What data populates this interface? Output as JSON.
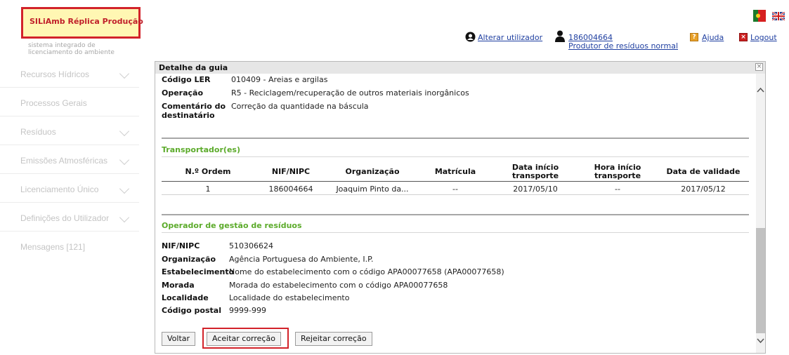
{
  "logo": {
    "title": "SILiAmb Réplica Produção",
    "subtitle_line1": "sistema integrado de",
    "subtitle_line2": "licenciamento do ambiente"
  },
  "sidebar": {
    "items": [
      {
        "label": "Recursos Hídricos",
        "has_chevron": true
      },
      {
        "label": "Processos Gerais",
        "has_chevron": false
      },
      {
        "label": "Resíduos",
        "has_chevron": true
      },
      {
        "label": "Emissões Atmosféricas",
        "has_chevron": true
      },
      {
        "label": "Licenciamento Único",
        "has_chevron": true
      },
      {
        "label": "Definições do Utilizador",
        "has_chevron": true
      },
      {
        "label": "Mensagens [121]",
        "has_chevron": false
      }
    ]
  },
  "header": {
    "change_user": "Alterar utilizador",
    "user_id": "186004664",
    "user_role": "Produtor de resíduos normal",
    "help": "Ajuda",
    "logout": "Logout"
  },
  "modal": {
    "title": "Detalhe da guia",
    "top_fields": [
      {
        "label": "Código LER",
        "value": "010409 - Areias e argilas"
      },
      {
        "label": "Operação",
        "value": "R5 - Reciclagem/recuperação de outros materiais inorgânicos"
      },
      {
        "label_line1": "Comentário do",
        "label_line2": "destinatário",
        "value": "Correção da quantidade na báscula"
      }
    ],
    "transport": {
      "title": "Transportador(es)",
      "columns": [
        "N.º Ordem",
        "NIF/NIPC",
        "Organização",
        "Matrícula",
        "Data início transporte",
        "Hora início transporte",
        "Data de validade"
      ],
      "col_date_start_1": "Data início",
      "col_date_start_2": "transporte",
      "col_hour_start_1": "Hora início",
      "col_hour_start_2": "transporte",
      "rows": [
        {
          "ordem": "1",
          "nif": "186004664",
          "org": "Joaquim Pinto da...",
          "matricula": "--",
          "data_inicio": "2017/05/10",
          "hora_inicio": "--",
          "validade": "2017/05/12"
        }
      ]
    },
    "operator": {
      "title": "Operador de gestão de resíduos",
      "fields": [
        {
          "label": "NIF/NIPC",
          "value": "510306624"
        },
        {
          "label": "Organização",
          "value": "Agência Portuguesa do Ambiente, I.P."
        },
        {
          "label": "Estabelecimento",
          "value": "Nome do estabelecimento com o código APA00077658 (APA00077658)"
        },
        {
          "label": "Morada",
          "value": "Morada do estabelecimento com o código APA00077658"
        },
        {
          "label": "Localidade",
          "value": "Localidade do estabelecimento"
        },
        {
          "label": "Código postal",
          "value": "9999-999"
        }
      ]
    },
    "buttons": {
      "back": "Voltar",
      "accept": "Aceitar correção",
      "reject": "Rejeitar correção"
    }
  },
  "colors": {
    "accent_green": "#5cab2b",
    "highlight_red": "#d2232a",
    "link_blue": "#1f3fa0"
  },
  "icons": [
    "user-switch-icon",
    "user-icon",
    "help-icon",
    "logout-icon",
    "portugal-flag-icon",
    "uk-flag-icon",
    "close-icon",
    "scroll-up-icon",
    "scroll-down-icon",
    "chevron-down-icon"
  ]
}
